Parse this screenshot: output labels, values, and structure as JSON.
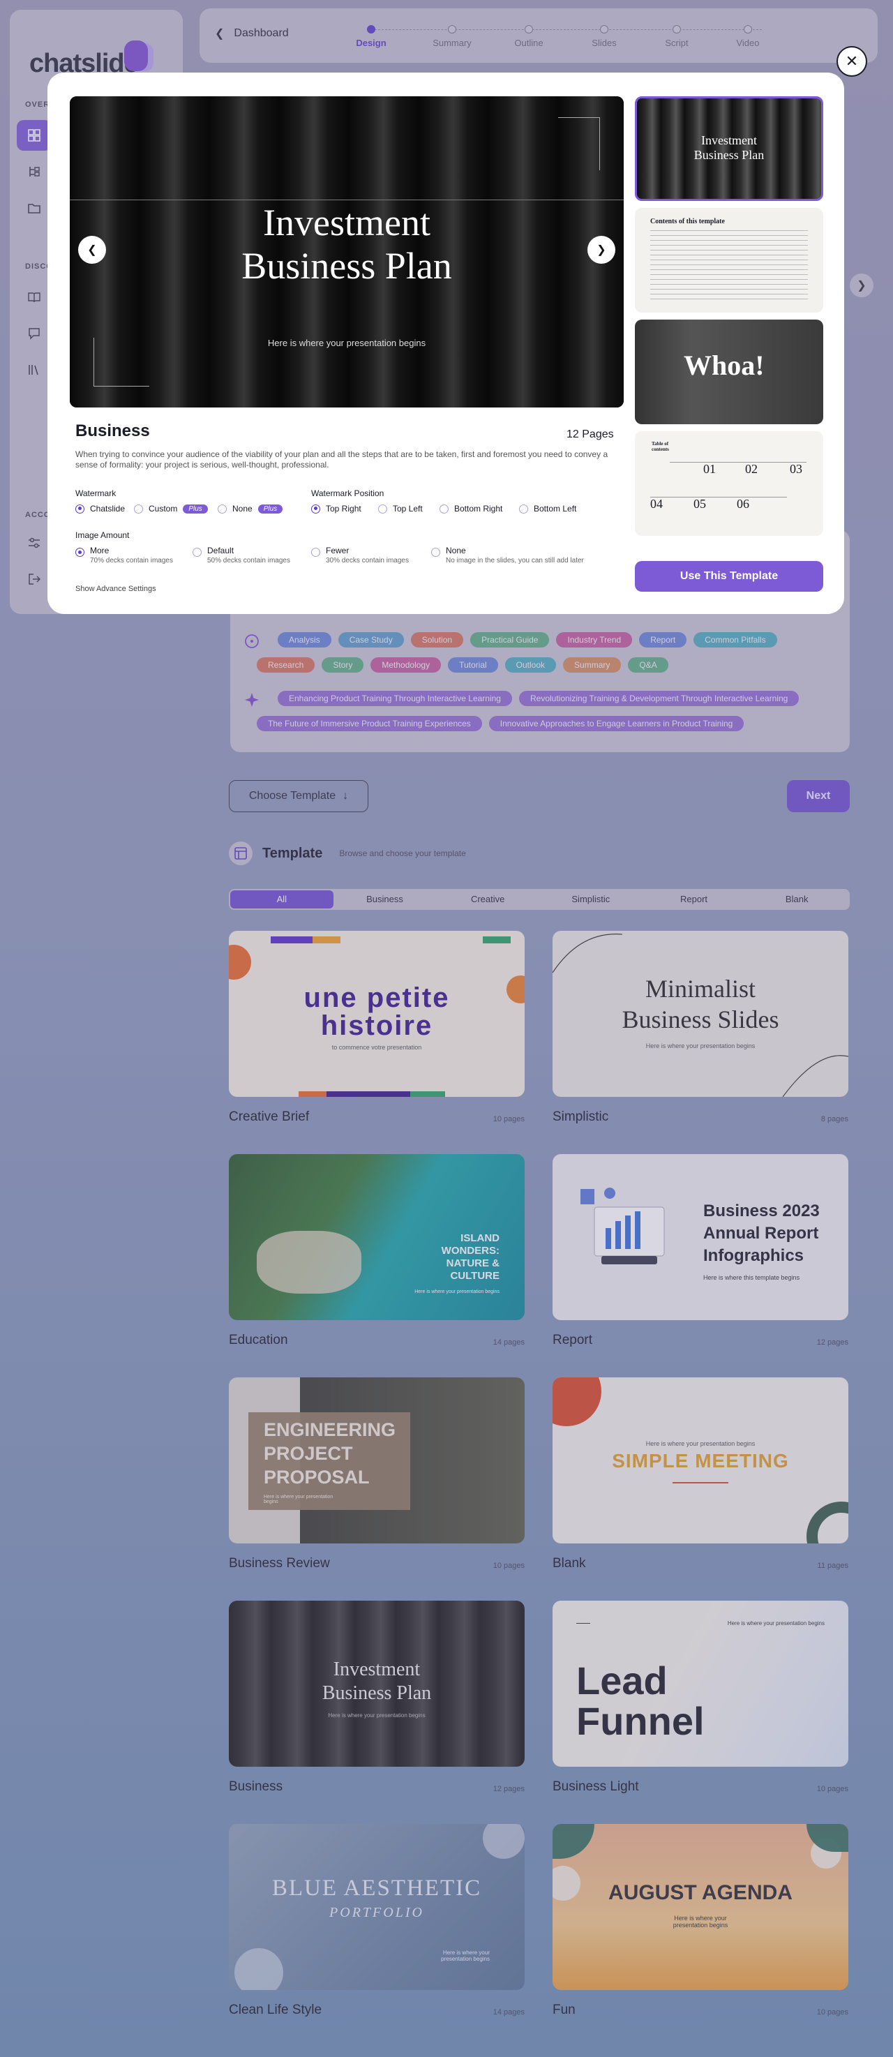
{
  "sidebar": {
    "logo": "chatslide",
    "sections": {
      "overview": "OVER",
      "discover": "DISCO",
      "account": "ACCO"
    }
  },
  "topbar": {
    "back_label": "Dashboard",
    "steps": [
      "Design",
      "Summary",
      "Outline",
      "Slides",
      "Script",
      "Video"
    ],
    "active_step": 0
  },
  "modal": {
    "hero_title_l1": "Investment",
    "hero_title_l2": "Business Plan",
    "hero_sub": "Here is where your presentation begins",
    "side_thumbs": {
      "t1_l1": "Investment",
      "t1_l2": "Business Plan",
      "t2": "Contents of this template",
      "t3": "Whoa!",
      "t4_a": "Table of contents",
      "t4_nums": [
        "01",
        "02",
        "03",
        "04",
        "05",
        "06"
      ]
    },
    "title": "Business",
    "pages": "12 Pages",
    "description": "When trying to convince your audience of the viability of your plan and all the steps that are to be taken, first and foremost you need to convey a sense of formality: your project is serious, well-thought, professional.",
    "watermark": {
      "label": "Watermark",
      "options": [
        "Chatslide",
        "Custom",
        "None"
      ],
      "plus": "Plus",
      "selected": 0
    },
    "watermark_position": {
      "label": "Watermark Position",
      "options": [
        "Top Right",
        "Top Left",
        "Bottom Right",
        "Bottom Left"
      ],
      "selected": 0
    },
    "image_amount": {
      "label": "Image Amount",
      "options": [
        {
          "name": "More",
          "desc": "70% decks contain images"
        },
        {
          "name": "Default",
          "desc": "50% decks contain images"
        },
        {
          "name": "Fewer",
          "desc": "30% decks contain images"
        },
        {
          "name": "None",
          "desc": "No image in the slides, you can still add later"
        }
      ],
      "selected": 0
    },
    "advanced": "Show Advance Settings",
    "use_button": "Use This Template",
    "close_icon": "✕"
  },
  "chips": {
    "row1": [
      {
        "t": "Analysis",
        "c": "#4a6fd8"
      },
      {
        "t": "Case Study",
        "c": "#3b8fc7"
      },
      {
        "t": "Solution",
        "c": "#d85a38"
      },
      {
        "t": "Practical Guide",
        "c": "#3ba46a"
      },
      {
        "t": "Industry Trend",
        "c": "#c23d8c"
      },
      {
        "t": "Report",
        "c": "#4a6fd8"
      },
      {
        "t": "Common Pitfalls",
        "c": "#2aa3b8"
      }
    ],
    "row2": [
      {
        "t": "Research",
        "c": "#d85a38"
      },
      {
        "t": "Story",
        "c": "#3ba46a"
      },
      {
        "t": "Methodology",
        "c": "#c23d8c"
      },
      {
        "t": "Tutorial",
        "c": "#4a6fd8"
      },
      {
        "t": "Outlook",
        "c": "#2aa3b8"
      },
      {
        "t": "Summary",
        "c": "#d87a38"
      },
      {
        "t": "Q&A",
        "c": "#3ba46a"
      }
    ],
    "row3": [
      {
        "t": "Enhancing Product Training Through Interactive Learning",
        "c": "#7d4fd0"
      },
      {
        "t": "Revolutionizing Training & Development Through Interactive Learning",
        "c": "#7d4fd0"
      }
    ],
    "row4": [
      {
        "t": "The Future of Immersive Product Training Experiences",
        "c": "#7d4fd0"
      },
      {
        "t": "Innovative Approaches to Engage Learners in Product Training",
        "c": "#7d4fd0"
      }
    ]
  },
  "choose_template": "Choose Template",
  "next": "Next",
  "template_section": {
    "title": "Template",
    "subtitle": "Browse and choose your template"
  },
  "filters": [
    "All",
    "Business",
    "Creative",
    "Simplistic",
    "Report",
    "Blank"
  ],
  "cards": [
    {
      "name": "Creative Brief",
      "pages": "10 pages",
      "t1": "une petite",
      "t2": "histoire",
      "t3": "to commence votre presentation"
    },
    {
      "name": "Simplistic",
      "pages": "8 pages",
      "t1": "Minimalist",
      "t2": "Business Slides",
      "t3": "Here is where your presentation begins"
    },
    {
      "name": "Education",
      "pages": "14 pages",
      "t1": "ISLAND",
      "t2": "WONDERS:",
      "t3": "NATURE &",
      "t4": "CULTURE",
      "t5": "Here is where your presentation begins"
    },
    {
      "name": "Report",
      "pages": "12 pages",
      "t1": "Business 2023",
      "t2": "Annual Report",
      "t3": "Infographics",
      "t4": "Here is where this template begins"
    },
    {
      "name": "Business Review",
      "pages": "10 pages",
      "t1": "ENGINEERING",
      "t2": "PROJECT",
      "t3": "PROPOSAL",
      "t4": "Here is where your presentation begins"
    },
    {
      "name": "Blank",
      "pages": "11 pages",
      "t1": "Here is where your presentation begins",
      "t2": "SIMPLE MEETING"
    },
    {
      "name": "Business",
      "pages": "12 pages",
      "t1": "Investment",
      "t2": "Business Plan",
      "t3": "Here is where your presentation begins"
    },
    {
      "name": "Business Light",
      "pages": "10 pages",
      "t1": "Lead",
      "t2": "Funnel",
      "t3": "Here is where your presentation begins"
    },
    {
      "name": "Clean Life Style",
      "pages": "14 pages",
      "t1": "BLUE AESTHETIC",
      "t2": "PORTFOLIO",
      "t3": "Here is where your presentation begins"
    },
    {
      "name": "Fun",
      "pages": "10 pages",
      "t1": "AUGUST AGENDA",
      "t2": "Here is where your presentation begins"
    }
  ]
}
